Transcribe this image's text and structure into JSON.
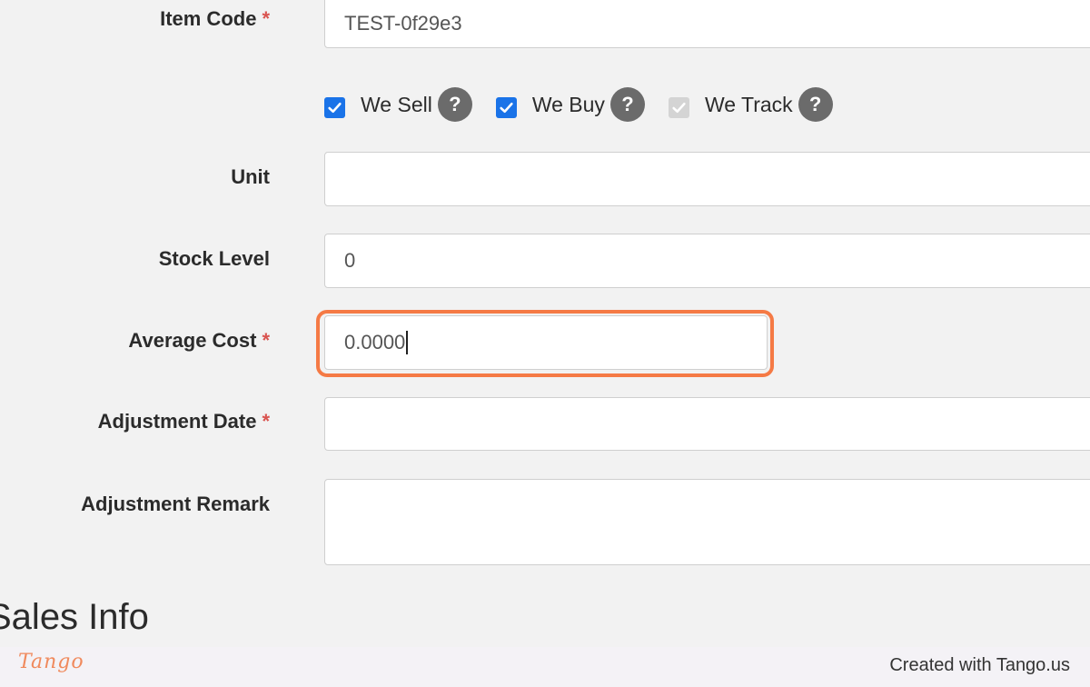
{
  "form": {
    "item_code": {
      "label": "Item Code",
      "required": "*",
      "value": "TEST-0f29e3"
    },
    "checkboxes": [
      {
        "label": "We Sell",
        "checked": true,
        "help": "?"
      },
      {
        "label": "We Buy",
        "checked": true,
        "help": "?"
      },
      {
        "label": "We Track",
        "checked": true,
        "disabled": true,
        "help": "?"
      }
    ],
    "unit": {
      "label": "Unit",
      "value": ""
    },
    "stock_level": {
      "label": "Stock Level",
      "value": "0"
    },
    "average_cost": {
      "label": "Average Cost",
      "required": "*",
      "value": "0.0000"
    },
    "adjustment_date": {
      "label": "Adjustment Date",
      "required": "*",
      "value": ""
    },
    "adjustment_remark": {
      "label": "Adjustment Remark",
      "value": ""
    }
  },
  "sections": {
    "sales_info": "Sales Info"
  },
  "footer": {
    "logo": "Tango",
    "credit": "Created with Tango.us"
  },
  "colors": {
    "highlight": "#f57a45",
    "checkbox_checked": "#1a73e8",
    "required": "#d9534f"
  }
}
